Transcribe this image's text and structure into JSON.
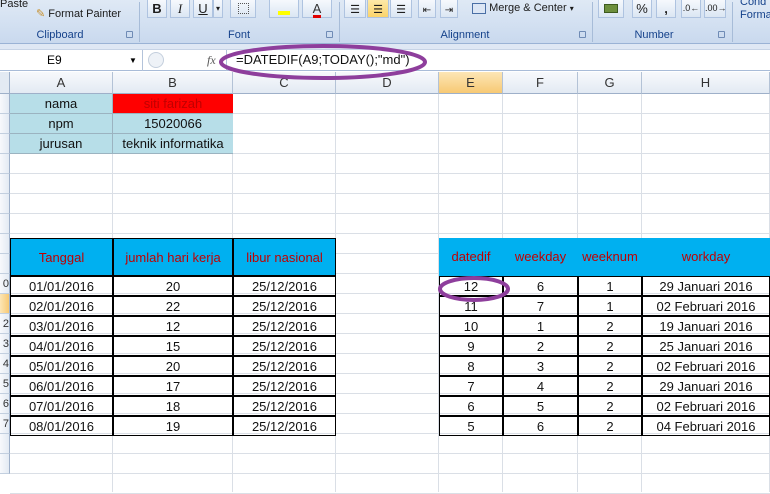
{
  "ribbon": {
    "clipboard": {
      "paste": "Paste",
      "format_painter": "Format Painter",
      "label": "Clipboard"
    },
    "font": {
      "bold": "B",
      "italic": "I",
      "underline": "U",
      "font_color_letter": "A",
      "label": "Font"
    },
    "alignment": {
      "merge_center": "Merge & Center",
      "label": "Alignment"
    },
    "number": {
      "percent": "%",
      "comma": ",",
      "label": "Number"
    },
    "styles": {
      "cond_line1": "Cond",
      "cond_line2": "Forma"
    }
  },
  "formula_bar": {
    "name_box": "E9",
    "fx": "fx",
    "formula": "=DATEDIF(A9;TODAY();\"md\")"
  },
  "columns": [
    "A",
    "B",
    "C",
    "D",
    "E",
    "F",
    "G",
    "H"
  ],
  "row_numbers": [
    "",
    "",
    "",
    "",
    "",
    "",
    "",
    "",
    "",
    "0",
    "",
    "2",
    "3",
    "4",
    "5",
    "6",
    "7",
    "",
    ""
  ],
  "info": [
    {
      "label": "nama",
      "value": "siti farizah"
    },
    {
      "label": "npm",
      "value": "15020066"
    },
    {
      "label": "jurusan",
      "value": "teknik informatika"
    }
  ],
  "left_table": {
    "headers": [
      "Tanggal",
      "jumlah hari kerja",
      "libur nasional"
    ],
    "rows": [
      [
        "01/01/2016",
        "20",
        "25/12/2016"
      ],
      [
        "02/01/2016",
        "22",
        "25/12/2016"
      ],
      [
        "03/01/2016",
        "12",
        "25/12/2016"
      ],
      [
        "04/01/2016",
        "15",
        "25/12/2016"
      ],
      [
        "05/01/2016",
        "20",
        "25/12/2016"
      ],
      [
        "06/01/2016",
        "17",
        "25/12/2016"
      ],
      [
        "07/01/2016",
        "18",
        "25/12/2016"
      ],
      [
        "08/01/2016",
        "19",
        "25/12/2016"
      ]
    ]
  },
  "right_table": {
    "headers": [
      "datedif",
      "weekday",
      "weeknum",
      "workday"
    ],
    "rows": [
      [
        "12",
        "6",
        "1",
        "29 Januari 2016"
      ],
      [
        "11",
        "7",
        "1",
        "02 Februari 2016"
      ],
      [
        "10",
        "1",
        "2",
        "19 Januari 2016"
      ],
      [
        "9",
        "2",
        "2",
        "25 Januari 2016"
      ],
      [
        "8",
        "3",
        "2",
        "02 Februari 2016"
      ],
      [
        "7",
        "4",
        "2",
        "29 Januari 2016"
      ],
      [
        "6",
        "5",
        "2",
        "02 Februari 2016"
      ],
      [
        "5",
        "6",
        "2",
        "04 Februari 2016"
      ]
    ]
  },
  "colors": {
    "header_fill": "#00b0f0",
    "header_text": "#c00000",
    "info_label_fill": "#b7dee8",
    "name_fill": "#ff0000",
    "annotation": "#8e3e9c"
  }
}
